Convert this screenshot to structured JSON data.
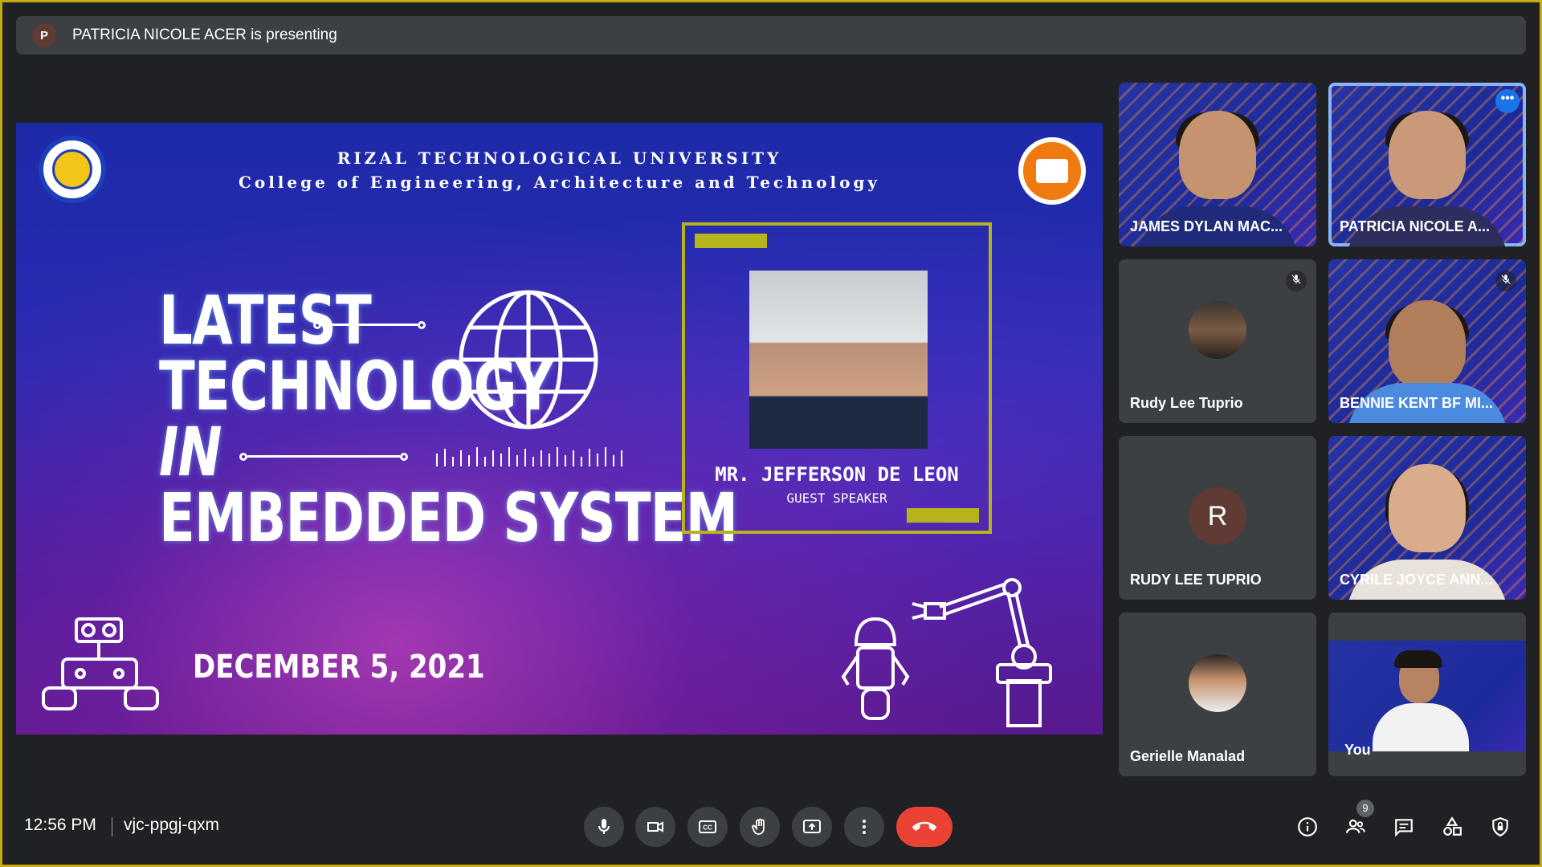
{
  "banner": {
    "avatar_letter": "P",
    "text": "PATRICIA NICOLE ACER is presenting"
  },
  "slide": {
    "university": "RIZAL TECHNOLOGICAL UNIVERSITY",
    "college": "College of Engineering, Architecture and Technology",
    "title_lines": [
      "LATEST",
      "TECHNOLOGY",
      "IN",
      "EMBEDDED SYSTEM"
    ],
    "date": "DECEMBER 5, 2021",
    "speaker_name": "MR. JEFFERSON DE LEON",
    "speaker_role": "GUEST SPEAKER"
  },
  "participants": [
    {
      "name": "JAMES DYLAN MAC...",
      "type": "video"
    },
    {
      "name": "PATRICIA NICOLE A...",
      "type": "video",
      "active": true
    },
    {
      "name": "Rudy Lee Tuprio",
      "type": "avatar",
      "muted": true
    },
    {
      "name": "BENNIE KENT BF MI...",
      "type": "video",
      "muted": true
    },
    {
      "name": "RUDY LEE TUPRIO",
      "type": "letter",
      "letter": "R"
    },
    {
      "name": "CYRILE JOYCE ANN...",
      "type": "video"
    },
    {
      "name": "Gerielle Manalad",
      "type": "avatar"
    },
    {
      "name": "You",
      "type": "video"
    }
  ],
  "footer": {
    "time": "12:56 PM",
    "meeting_code": "vjc-ppgj-qxm",
    "people_count": "9"
  },
  "colors": {
    "end_call": "#ea4335",
    "active_outline": "#8ab4f8",
    "frame_accent": "#b5b41c"
  }
}
